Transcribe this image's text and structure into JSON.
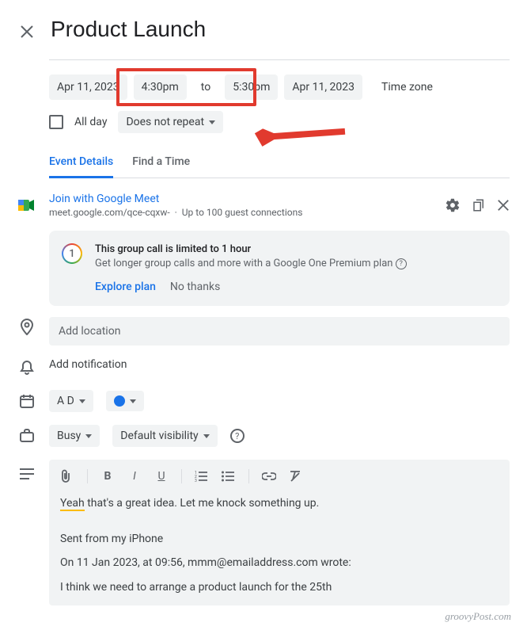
{
  "header": {
    "title": "Product Launch"
  },
  "datetime": {
    "start_date": "Apr 11, 2023",
    "start_time": "4:30pm",
    "to": "to",
    "end_time": "5:30pm",
    "end_date": "Apr 11, 2023",
    "timezone_label": "Time zone",
    "all_day_label": "All day",
    "repeat": "Does not repeat"
  },
  "tabs": {
    "details": "Event Details",
    "find_time": "Find a Time"
  },
  "meet": {
    "join_label": "Join with Google Meet",
    "url": "meet.google.com/qce-cqxw-",
    "dot": "·",
    "guest_info": "Up to 100 guest connections"
  },
  "one_promo": {
    "badge": "1",
    "title": "This group call is limited to 1 hour",
    "subtitle": "Get longer group calls and more with a Google One Premium plan",
    "explore": "Explore plan",
    "no_thanks": "No thanks"
  },
  "location": {
    "placeholder": "Add location"
  },
  "notification": {
    "label": "Add notification"
  },
  "calendar": {
    "owner_initials": "A D"
  },
  "availability": {
    "busy": "Busy",
    "visibility": "Default visibility"
  },
  "description": {
    "line1_spell": "Yeah",
    "line1_rest": " that's a great idea. Let me knock something up.",
    "line2": "Sent from my iPhone",
    "line3": "On 11 Jan 2023, at 09:56, mmm@emailaddress.com wrote:",
    "line4": "I think we need to arrange a product launch for the 25th"
  },
  "watermark": "groovyPost.com"
}
